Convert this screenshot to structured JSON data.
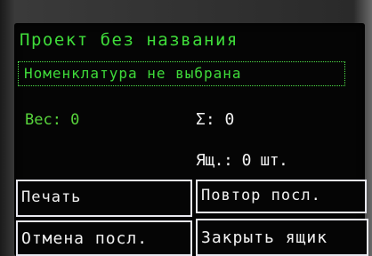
{
  "project": {
    "title": "Проект без названия"
  },
  "nomenclature": {
    "status": "Номенклатура не выбрана"
  },
  "readings": {
    "weight": "Вес: 0",
    "sum": "Σ: 0",
    "boxes": "Ящ.: 0 шт."
  },
  "buttons": {
    "print": "Печать",
    "repeat_last": "Повтор посл.",
    "cancel_last": "Отмена посл.",
    "close_box": "Закрыть ящик"
  },
  "colors": {
    "text_green": "#3fdc3a",
    "text_white": "#f2f2f2",
    "screen_bg": "#050505"
  }
}
